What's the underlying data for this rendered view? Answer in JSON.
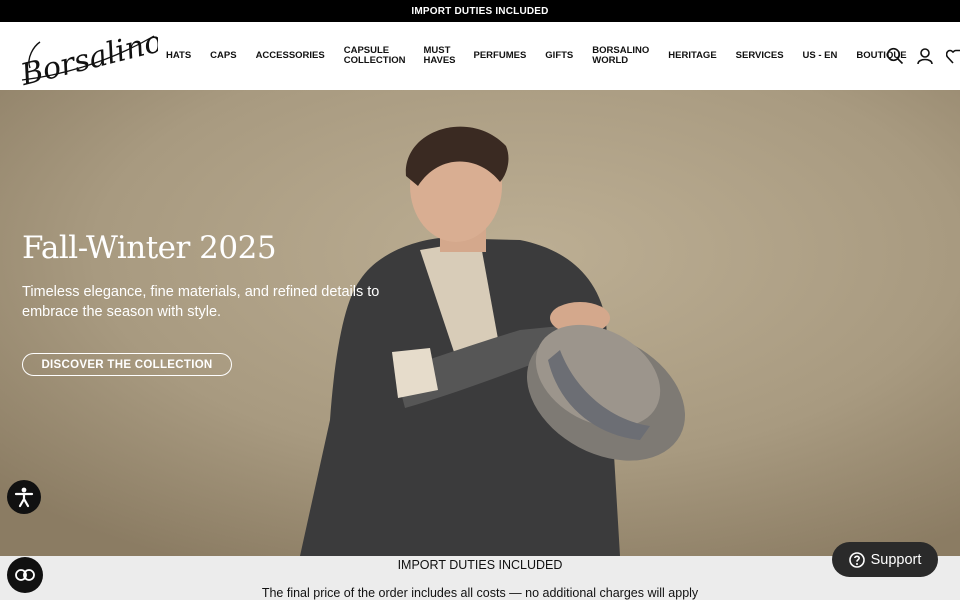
{
  "topbar": {
    "text": "IMPORT DUTIES INCLUDED"
  },
  "brand": {
    "logo_text": "Borsalino"
  },
  "nav": {
    "items": [
      {
        "label": "HATS"
      },
      {
        "label": "CAPS"
      },
      {
        "label": "ACCESSORIES"
      },
      {
        "label": "CAPSULE\nCOLLECTION"
      },
      {
        "label": "MUST\nHAVES"
      },
      {
        "label": "PERFUMES"
      },
      {
        "label": "GIFTS"
      },
      {
        "label": "BORSALINO\nWORLD"
      },
      {
        "label": "HERITAGE"
      },
      {
        "label": "SERVICES"
      },
      {
        "label": "US - EN"
      },
      {
        "label": "BOUTIQUE"
      }
    ]
  },
  "header_icons": [
    "search-icon",
    "user-icon",
    "wishlist-icon"
  ],
  "hero": {
    "title": "Fall-Winter 2025",
    "subtitle": "Timeless elegance, fine materials, and refined details to embrace the season with style.",
    "cta": "DISCOVER THE COLLECTION"
  },
  "notice": {
    "title": "IMPORT DUTIES INCLUDED",
    "text": "The final price of the order includes all costs — no additional charges will apply"
  },
  "support": {
    "label": "Support"
  },
  "colors": {
    "topbar": "#000000",
    "hero_bg": "#a99a7f",
    "notice_bg": "#ececec",
    "support_bg": "#2a2a2a"
  }
}
